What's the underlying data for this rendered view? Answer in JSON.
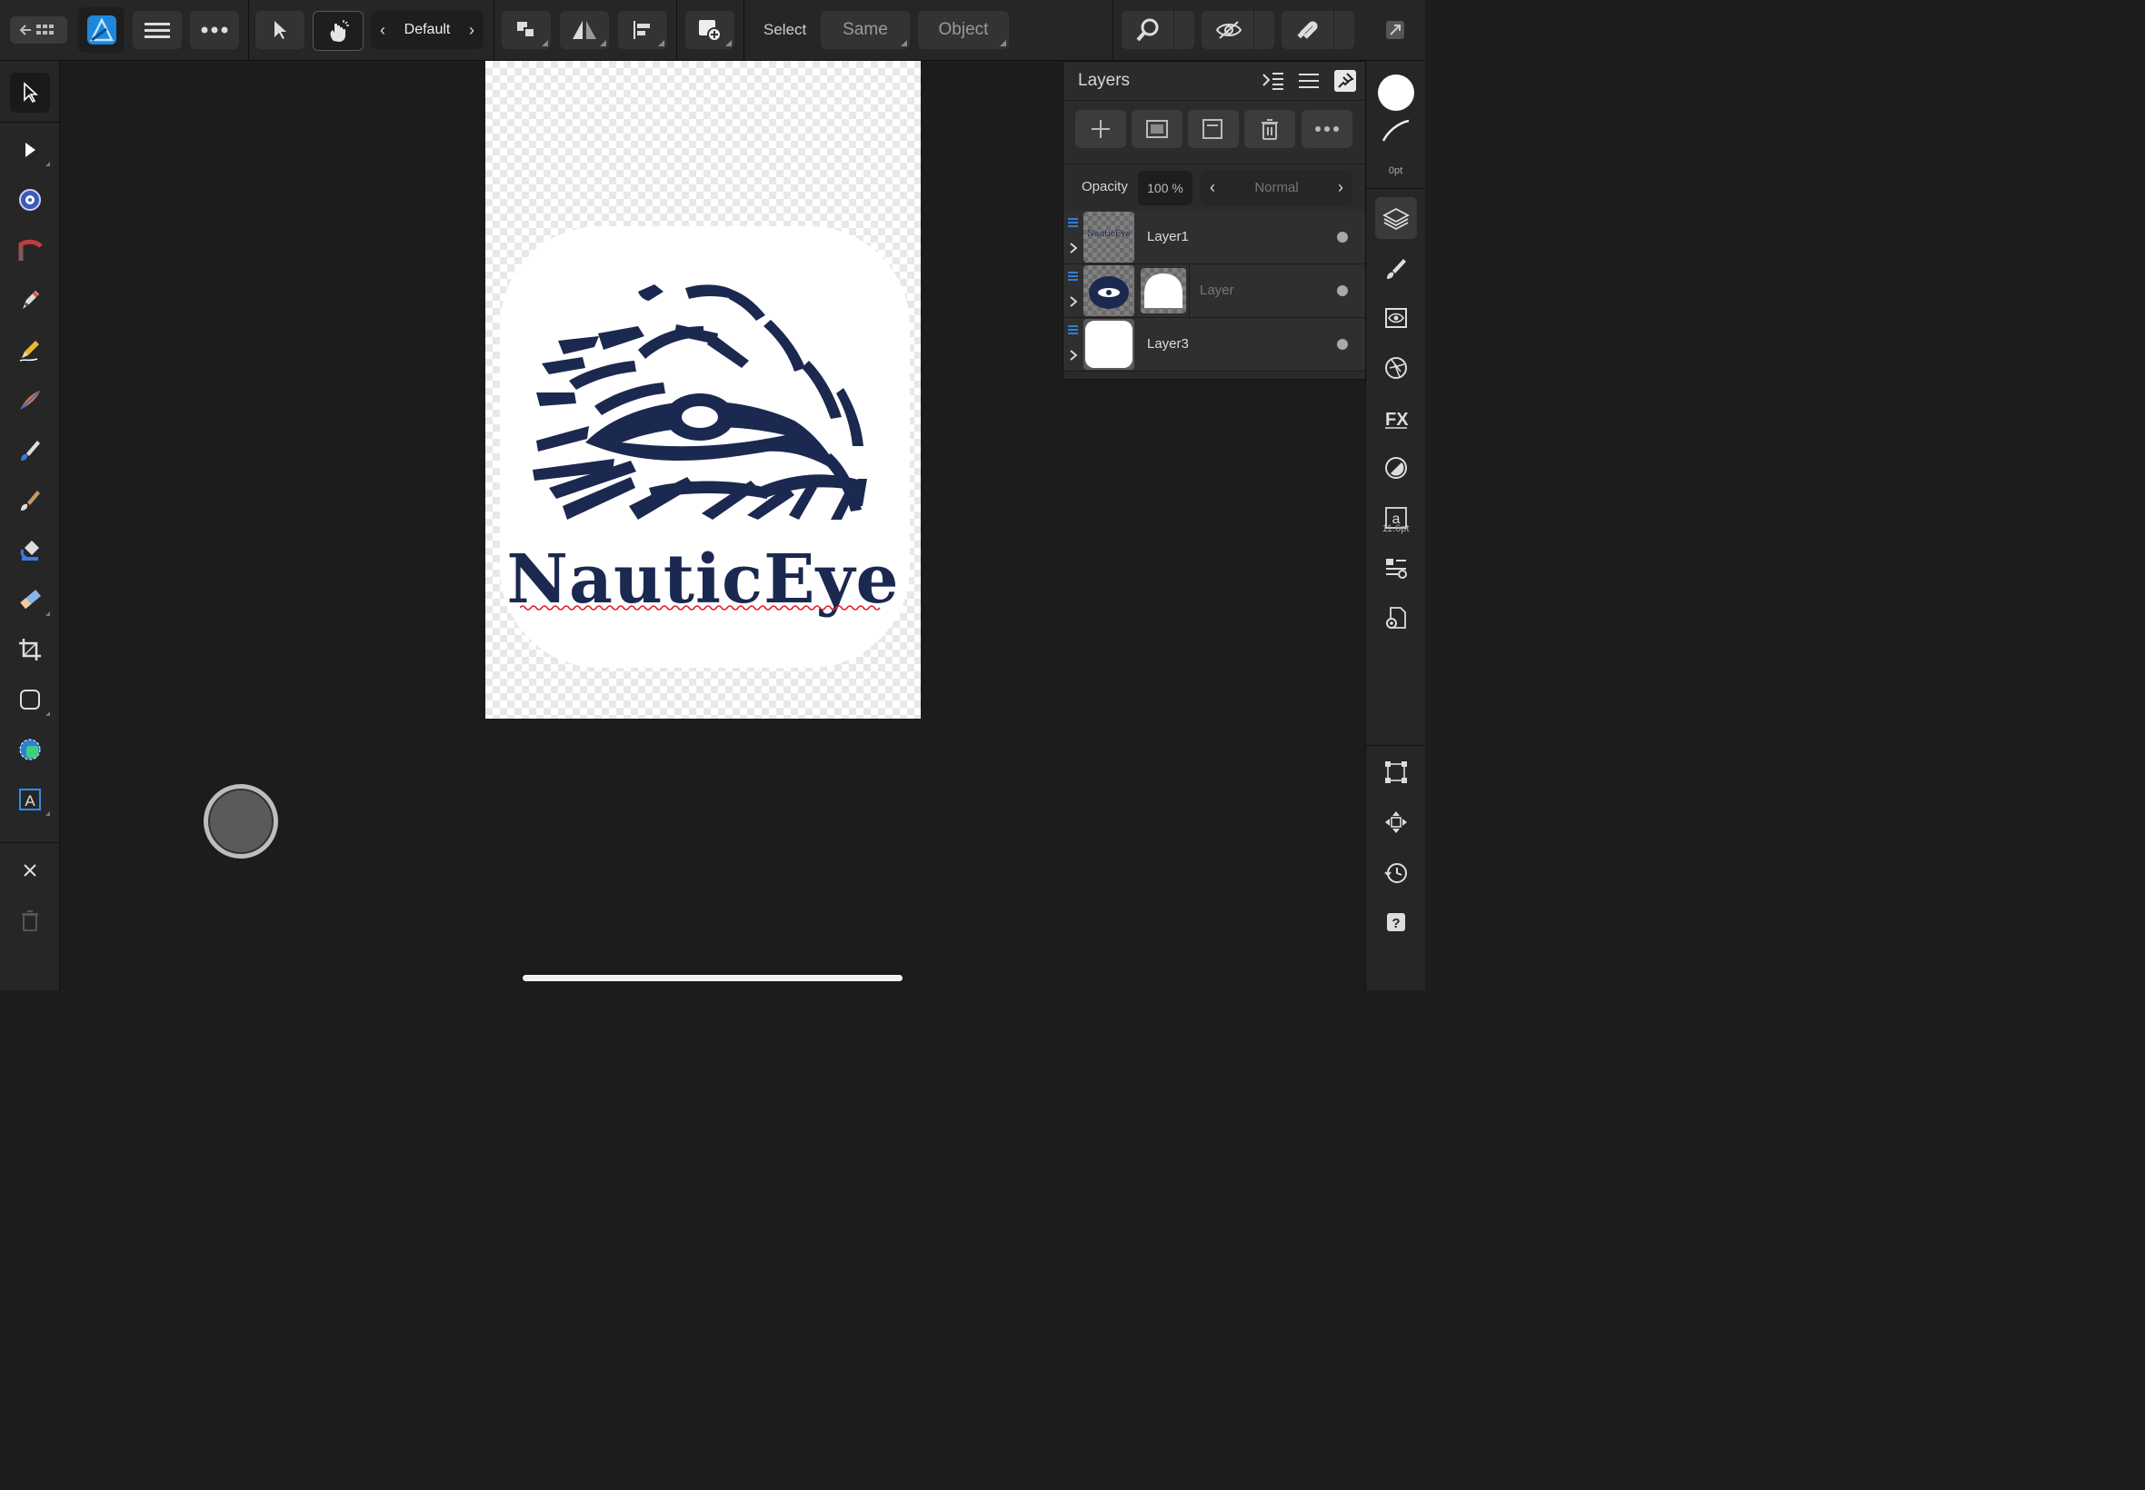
{
  "toolbar": {
    "persona_label": "Default",
    "select_label": "Select",
    "same_label": "Same",
    "object_label": "Object"
  },
  "document": {
    "logo_text": "NauticEye"
  },
  "layers_panel": {
    "title": "Layers",
    "opacity_label": "Opacity",
    "opacity_value": "100 %",
    "blend_mode": "Normal",
    "layers": [
      {
        "name": "Layer1"
      },
      {
        "name": "Layer"
      },
      {
        "name": "Layer3"
      }
    ]
  },
  "studio": {
    "stroke_width": "0pt",
    "text_size": "11.6pt"
  },
  "colors": {
    "accent": "#2f7fd6",
    "logo_navy": "#1b2850",
    "spell_underline": "#e0202a"
  }
}
